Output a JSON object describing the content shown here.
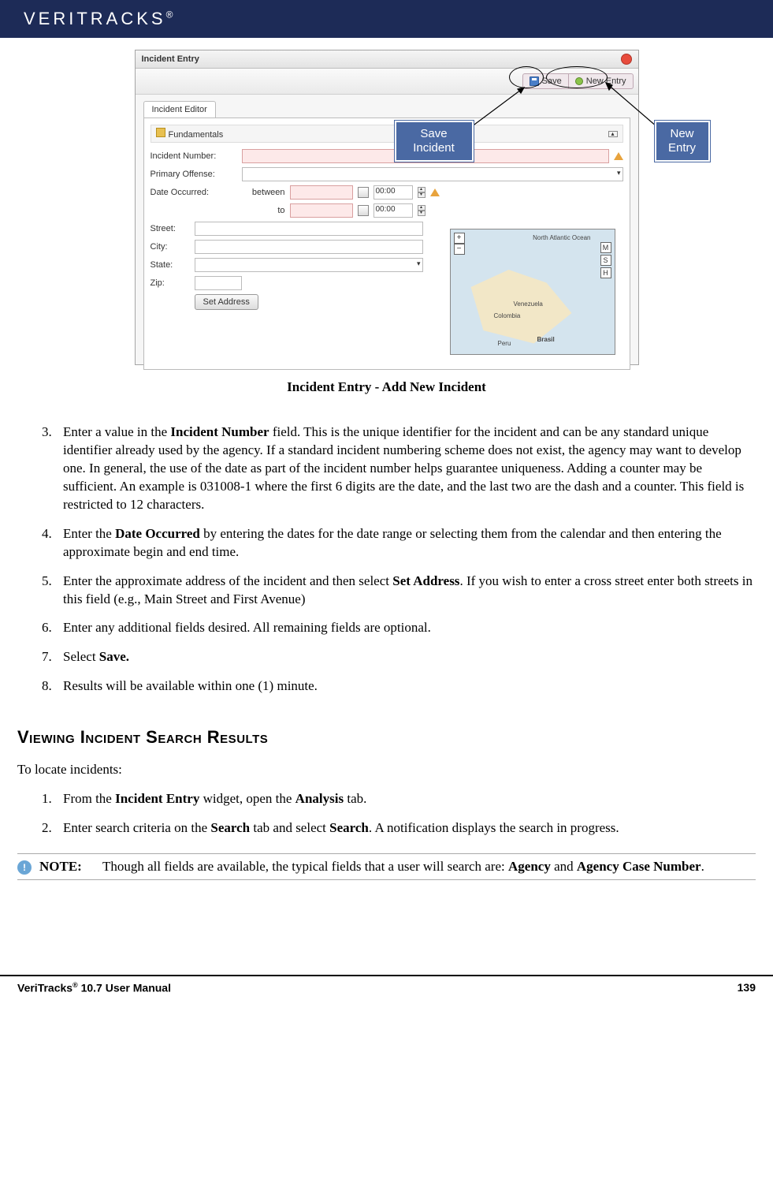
{
  "header": {
    "brand": "VERITRACKS",
    "reg": "®"
  },
  "screenshot": {
    "window_title": "Incident Entry",
    "toolbar": {
      "save": "Save",
      "new_entry": "New Entry"
    },
    "tab": "Incident Editor",
    "section": "Fundamentals",
    "labels": {
      "incident_number": "Incident Number:",
      "primary_offense": "Primary Offense:",
      "date_occurred": "Date Occurred:",
      "between": "between",
      "to": "to",
      "time_from": "00:00",
      "time_to": "00:00",
      "street": "Street:",
      "city": "City:",
      "state": "State:",
      "zip": "Zip:",
      "set_address": "Set Address"
    },
    "map": {
      "north_atlantic": "North Atlantic Ocean",
      "venezuela": "Venezuela",
      "colombia": "Colombia",
      "brasil": "Brasil",
      "peru": "Peru",
      "btn_m": "M",
      "btn_s": "S",
      "btn_h": "H"
    }
  },
  "callouts": {
    "save": "Save Incident",
    "new": "New Entry"
  },
  "caption": "Incident Entry - Add New Incident",
  "steps_a_start": 3,
  "steps_a": [
    {
      "pre": "Enter a value in the ",
      "b1": "Incident Number",
      "post": " field. This is the unique identifier for the incident and can be any standard unique identifier already used by the agency. If a standard incident numbering scheme does not exist, the agency may want to develop one. In general, the use of the date as part of the incident number helps guarantee uniqueness. Adding a counter may be sufficient. An example is 031008-1 where the first 6 digits are the date, and the last two are the dash and a counter. This field is restricted to 12 characters."
    },
    {
      "pre": "Enter the ",
      "b1": "Date Occurred",
      "post": " by entering the dates for the date range or selecting them from the calendar and then entering the approximate begin and end time."
    },
    {
      "pre": "Enter the approximate address of the incident and then select ",
      "b1": "Set Address",
      "post": ". If you wish to enter a cross street enter both streets in this field (e.g., Main Street and First Avenue)"
    },
    {
      "plain": "Enter any additional fields desired. All remaining fields are optional."
    },
    {
      "pre": "Select ",
      "b1": "Save.",
      "post": ""
    },
    {
      "plain": "Results will be available within one (1) minute."
    }
  ],
  "section_heading": "Viewing Incident Search Results",
  "intro": "To locate incidents:",
  "steps_b": [
    {
      "t1": "From the ",
      "b1": "Incident Entry",
      "t2": " widget, open the ",
      "b2": "Analysis",
      "t3": " tab."
    },
    {
      "t1": "Enter search criteria on the ",
      "b1": "Search",
      "t2": " tab and select ",
      "b2": "Search",
      "t3": ". A notification displays the search in progress."
    }
  ],
  "note": {
    "label": "NOTE:",
    "t1": "Though all fields are available, the typical fields that a user will search are: ",
    "b1": "Agency",
    "t2": " and ",
    "b2": "Agency Case Number",
    "t3": "."
  },
  "footer": {
    "left_pre": "VeriTracks",
    "left_sup": "®",
    "left_post": " 10.7 User Manual",
    "right": "139"
  }
}
